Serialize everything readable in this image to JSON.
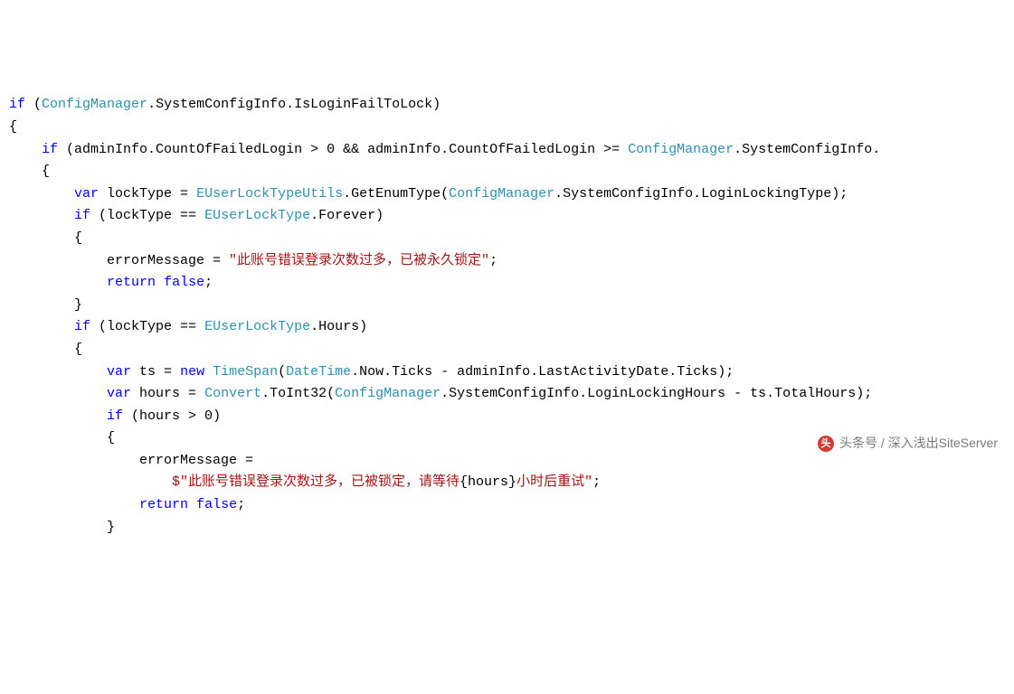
{
  "code": {
    "tokens": [
      {
        "cls": "kw",
        "t": "if"
      },
      {
        "cls": "blk",
        "t": " ("
      },
      {
        "cls": "type",
        "t": "ConfigManager"
      },
      {
        "cls": "blk",
        "t": ".SystemConfigInfo.IsLoginFailToLock)\n"
      },
      {
        "cls": "blk",
        "t": "{\n"
      },
      {
        "cls": "blk",
        "t": "    "
      },
      {
        "cls": "kw",
        "t": "if"
      },
      {
        "cls": "blk",
        "t": " (adminInfo.CountOfFailedLogin > 0 && adminInfo.CountOfFailedLogin >= "
      },
      {
        "cls": "type",
        "t": "ConfigManager"
      },
      {
        "cls": "blk",
        "t": ".SystemConfigInfo.\n"
      },
      {
        "cls": "blk",
        "t": "    {\n"
      },
      {
        "cls": "blk",
        "t": "        "
      },
      {
        "cls": "kw",
        "t": "var"
      },
      {
        "cls": "blk",
        "t": " lockType = "
      },
      {
        "cls": "type",
        "t": "EUserLockTypeUtils"
      },
      {
        "cls": "blk",
        "t": ".GetEnumType("
      },
      {
        "cls": "type",
        "t": "ConfigManager"
      },
      {
        "cls": "blk",
        "t": ".SystemConfigInfo.LoginLockingType);\n"
      },
      {
        "cls": "blk",
        "t": "        "
      },
      {
        "cls": "kw",
        "t": "if"
      },
      {
        "cls": "blk",
        "t": " (lockType == "
      },
      {
        "cls": "type",
        "t": "EUserLockType"
      },
      {
        "cls": "blk",
        "t": ".Forever)\n"
      },
      {
        "cls": "blk",
        "t": "        {\n"
      },
      {
        "cls": "blk",
        "t": "            errorMessage = "
      },
      {
        "cls": "str",
        "t": "\"此账号错误登录次数过多，已被永久锁定\""
      },
      {
        "cls": "blk",
        "t": ";\n"
      },
      {
        "cls": "blk",
        "t": "            "
      },
      {
        "cls": "kw",
        "t": "return"
      },
      {
        "cls": "blk",
        "t": " "
      },
      {
        "cls": "kw",
        "t": "false"
      },
      {
        "cls": "blk",
        "t": ";\n"
      },
      {
        "cls": "blk",
        "t": "        }\n"
      },
      {
        "cls": "blk",
        "t": "        "
      },
      {
        "cls": "kw",
        "t": "if"
      },
      {
        "cls": "blk",
        "t": " (lockType == "
      },
      {
        "cls": "type",
        "t": "EUserLockType"
      },
      {
        "cls": "blk",
        "t": ".Hours)\n"
      },
      {
        "cls": "blk",
        "t": "        {\n"
      },
      {
        "cls": "blk",
        "t": "            "
      },
      {
        "cls": "kw",
        "t": "var"
      },
      {
        "cls": "blk",
        "t": " ts = "
      },
      {
        "cls": "kw",
        "t": "new"
      },
      {
        "cls": "blk",
        "t": " "
      },
      {
        "cls": "type",
        "t": "TimeSpan"
      },
      {
        "cls": "blk",
        "t": "("
      },
      {
        "cls": "type",
        "t": "DateTime"
      },
      {
        "cls": "blk",
        "t": ".Now.Ticks - adminInfo.LastActivityDate.Ticks);\n"
      },
      {
        "cls": "blk",
        "t": "            "
      },
      {
        "cls": "kw",
        "t": "var"
      },
      {
        "cls": "blk",
        "t": " hours = "
      },
      {
        "cls": "type",
        "t": "Convert"
      },
      {
        "cls": "blk",
        "t": ".ToInt32("
      },
      {
        "cls": "type",
        "t": "ConfigManager"
      },
      {
        "cls": "blk",
        "t": ".SystemConfigInfo.LoginLockingHours - ts.TotalHours);\n"
      },
      {
        "cls": "blk",
        "t": "            "
      },
      {
        "cls": "kw",
        "t": "if"
      },
      {
        "cls": "blk",
        "t": " (hours > 0)\n"
      },
      {
        "cls": "blk",
        "t": "            {\n"
      },
      {
        "cls": "blk",
        "t": "                errorMessage =\n"
      },
      {
        "cls": "blk",
        "t": "                    "
      },
      {
        "cls": "str",
        "t": "$\"此账号错误登录次数过多，已被锁定，请等待"
      },
      {
        "cls": "blk",
        "t": "{hours}"
      },
      {
        "cls": "str",
        "t": "小时后重试\""
      },
      {
        "cls": "blk",
        "t": ";\n"
      },
      {
        "cls": "blk",
        "t": "                "
      },
      {
        "cls": "kw",
        "t": "return"
      },
      {
        "cls": "blk",
        "t": " "
      },
      {
        "cls": "kw",
        "t": "false"
      },
      {
        "cls": "blk",
        "t": ";\n"
      },
      {
        "cls": "blk",
        "t": "            }"
      }
    ]
  },
  "watermark": {
    "logo_letter": "头",
    "text": "头条号 / 深入浅出SiteServer"
  }
}
